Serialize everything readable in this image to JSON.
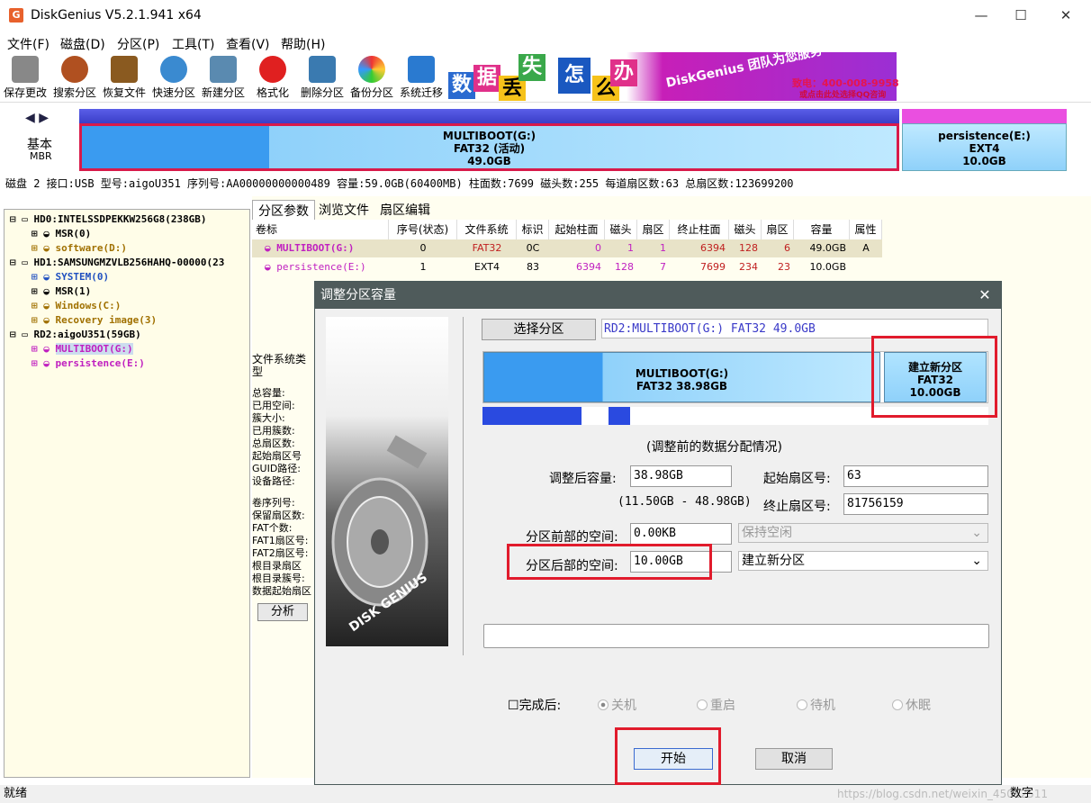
{
  "app": {
    "title": "DiskGenius V5.2.1.941 x64",
    "icon": "G"
  },
  "menu": [
    "文件(F)",
    "磁盘(D)",
    "分区(P)",
    "工具(T)",
    "查看(V)",
    "帮助(H)"
  ],
  "toolbar": [
    "保存更改",
    "搜索分区",
    "恢复文件",
    "快速分区",
    "新建分区",
    "格式化",
    "删除分区",
    "备份分区",
    "系统迁移"
  ],
  "banner": {
    "chars": [
      "数",
      "据",
      "丢",
      "失",
      "怎",
      "么",
      "办"
    ],
    "slogan": "DiskGenius 团队为您服务",
    "phone": "致电：400-008-9958",
    "qq": "或点击此处选择QQ咨询"
  },
  "diskmap": {
    "nav": "◀ ▶",
    "type": "基本",
    "scheme": "MBR",
    "part_g": {
      "name": "MULTIBOOT(G:)",
      "fs": "FAT32 (活动)",
      "size": "49.0GB"
    },
    "part_e": {
      "name": "persistence(E:)",
      "fs": "EXT4",
      "size": "10.0GB"
    }
  },
  "diskinfo": "磁盘 2 接口:USB  型号:aigoU351  序列号:AA00000000000489  容量:59.0GB(60400MB)  柱面数:7699  磁头数:255  每道扇区数:63  总扇区数:123699200",
  "tree": [
    {
      "text": "HD0:INTELSSDPEKKW256G8(238GB)",
      "color": "#000"
    },
    {
      "text": "MSR(0)",
      "color": "#000"
    },
    {
      "text": "software(D:)",
      "color": "#a07000"
    },
    {
      "text": "HD1:SAMSUNGMZVLB256HAHQ-00000(23",
      "color": "#000"
    },
    {
      "text": "SYSTEM(0)",
      "color": "#2050c0"
    },
    {
      "text": "MSR(1)",
      "color": "#000"
    },
    {
      "text": "Windows(C:)",
      "color": "#a07000"
    },
    {
      "text": "Recovery image(3)",
      "color": "#a07000"
    },
    {
      "text": "RD2:aigoU351(59GB)",
      "color": "#000"
    },
    {
      "text": "MULTIBOOT(G:)",
      "color": "#c020c0"
    },
    {
      "text": "persistence(E:)",
      "color": "#c020c0"
    }
  ],
  "tabs": [
    "分区参数",
    "浏览文件",
    "扇区编辑"
  ],
  "table": {
    "headers": [
      "卷标",
      "序号(状态)",
      "文件系统",
      "标识",
      "起始柱面",
      "磁头",
      "扇区",
      "终止柱面",
      "磁头",
      "扇区",
      "容量",
      "属性"
    ],
    "rows": [
      [
        "MULTIBOOT(G:)",
        "0",
        "FAT32",
        "0C",
        "0",
        "1",
        "1",
        "6394",
        "128",
        "6",
        "49.0GB",
        "A"
      ],
      [
        "persistence(E:)",
        "1",
        "EXT4",
        "83",
        "6394",
        "128",
        "7",
        "7699",
        "234",
        "23",
        "10.0GB",
        ""
      ]
    ]
  },
  "info_labels": [
    "文件系统类型",
    "总容量:",
    "已用空间:",
    "簇大小:",
    "已用簇数:",
    "总扇区数:",
    "起始扇区号",
    "GUID路径:",
    "设备路径:",
    "卷序列号:",
    "保留扇区数:",
    "FAT个数:",
    "FAT1扇区号:",
    "FAT2扇区号:",
    "根目录扇区",
    "根目录簇号:",
    "数据起始扇区"
  ],
  "analyze_label": "分析",
  "status": {
    "left": "就绪",
    "right": "数字",
    "watermark": "https://blog.csdn.net/weixin_45012511"
  },
  "dialog": {
    "title": "调整分区容量",
    "select_btn": "选择分区",
    "selected_info": "RD2:MULTIBOOT(G:) FAT32 49.0GB",
    "bar_g": {
      "name": "MULTIBOOT(G:)",
      "fs": "FAT32 38.98GB"
    },
    "bar_new": {
      "name": "建立新分区",
      "fs": "FAT32",
      "size": "10.00GB"
    },
    "caption": "(调整前的数据分配情况)",
    "new_size_label": "调整后容量:",
    "new_size": "38.98GB",
    "range": "(11.50GB - 48.98GB)",
    "start_sector_label": "起始扇区号:",
    "start_sector": "63",
    "end_sector_label": "终止扇区号:",
    "end_sector": "81756159",
    "front_space_label": "分区前部的空间:",
    "front_space": "0.00KB",
    "front_action": "保持空闲",
    "back_space_label": "分区后部的空间:",
    "back_space": "10.00GB",
    "back_action": "建立新分区",
    "after_label": "完成后:",
    "after_options": [
      "关机",
      "重启",
      "待机",
      "休眠"
    ],
    "start_btn": "开始",
    "cancel_btn": "取消"
  }
}
